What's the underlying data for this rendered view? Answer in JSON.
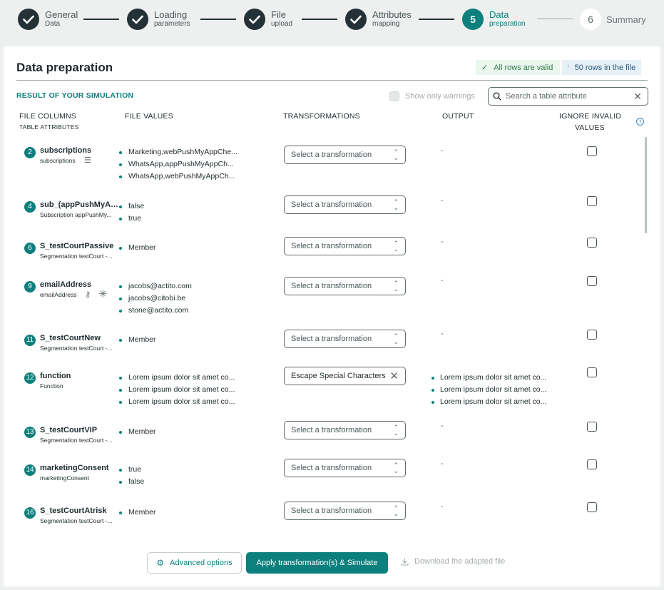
{
  "stepper": {
    "steps": [
      {
        "title": "General",
        "sub": "Data",
        "status": "done"
      },
      {
        "title": "Loading",
        "sub": "parameters",
        "status": "done"
      },
      {
        "title": "File",
        "sub": "upload",
        "status": "done"
      },
      {
        "title": "Attributes",
        "sub": "mapping",
        "status": "done"
      },
      {
        "number": "5",
        "title": "Data",
        "sub": "preparation",
        "status": "active"
      },
      {
        "number": "6",
        "title": "Summary",
        "sub": "",
        "status": "todo"
      }
    ]
  },
  "page": {
    "title": "Data preparation",
    "valid_badge": "All rows are valid",
    "rows_badge": "50 rows in the file",
    "sim_heading": "RESULT OF YOUR SIMULATION",
    "warnings_toggle": "Show only warnings",
    "search_placeholder": "Search a table attribute"
  },
  "columns": {
    "file_columns": "FILE COLUMNS",
    "table_attributes": "TABLE ATTRIBUTES",
    "file_values": "FILE VALUES",
    "transformations": "TRANSFORMATIONS",
    "output": "OUTPUT",
    "ignore_line1": "IGNORE INVALID",
    "ignore_line2": "VALUES"
  },
  "rows": [
    {
      "num": "2",
      "name": "subscriptions",
      "sub": "subscriptions",
      "values": [
        "Marketing,webPushMyAppChe...",
        "WhatsApp,appPushMyAppCh...",
        "WhatsApp,webPushMyAppCh..."
      ],
      "transformation": "Select a transformation",
      "output": "-"
    },
    {
      "num": "4",
      "name": "sub_(appPushMyAp...",
      "sub": "Subscription appPushMy...",
      "values": [
        "false",
        "true"
      ],
      "transformation": "Select a transformation",
      "output": "-"
    },
    {
      "num": "6",
      "name": "S_testCourtPassive",
      "sub": "Segmentation testCourt -...",
      "values": [
        "Member"
      ],
      "transformation": "Select a transformation",
      "output": "-"
    },
    {
      "num": "9",
      "name": "emailAddress",
      "sub": "emailAddress",
      "values": [
        "jacobs@actito.com",
        "jacobs@citobi.be",
        "stone@actito.com"
      ],
      "transformation": "Select a transformation",
      "output": "-"
    },
    {
      "num": "11",
      "name": "S_testCourtNew",
      "sub": "Segmentation testCourt -...",
      "values": [
        "Member"
      ],
      "transformation": "Select a transformation",
      "output": "-"
    },
    {
      "num": "12",
      "name": "function",
      "sub": "Function",
      "values": [
        "Lorem ipsum dolor sit amet co...",
        "Lorem ipsum dolor sit amet co...",
        "Lorem ipsum dolor sit amet co..."
      ],
      "transformation": "Escape Special Characters",
      "output_values": [
        "Lorem ipsum dolor sit amet co...",
        "Lorem ipsum dolor sit amet co...",
        "Lorem ipsum dolor sit amet co..."
      ]
    },
    {
      "num": "13",
      "name": "S_testCourtVIP",
      "sub": "Segmentation testCourt -...",
      "values": [
        "Member"
      ],
      "transformation": "Select a transformation",
      "output": "-"
    },
    {
      "num": "14",
      "name": "marketingConsent",
      "sub": "marketingConsent",
      "values": [
        "true",
        "false"
      ],
      "transformation": "Select a transformation",
      "output": "-"
    },
    {
      "num": "16",
      "name": "S_testCourtAtrisk",
      "sub": "Segmentation testCourt -...",
      "values": [
        "Member"
      ],
      "transformation": "Select a transformation",
      "output": "-"
    }
  ],
  "footer": {
    "advanced": "Advanced options",
    "apply": "Apply transformation(s) & Simulate",
    "download": "Download the adapted file"
  },
  "colors": {
    "accent": "#0d7f7c",
    "dark": "#243136"
  }
}
